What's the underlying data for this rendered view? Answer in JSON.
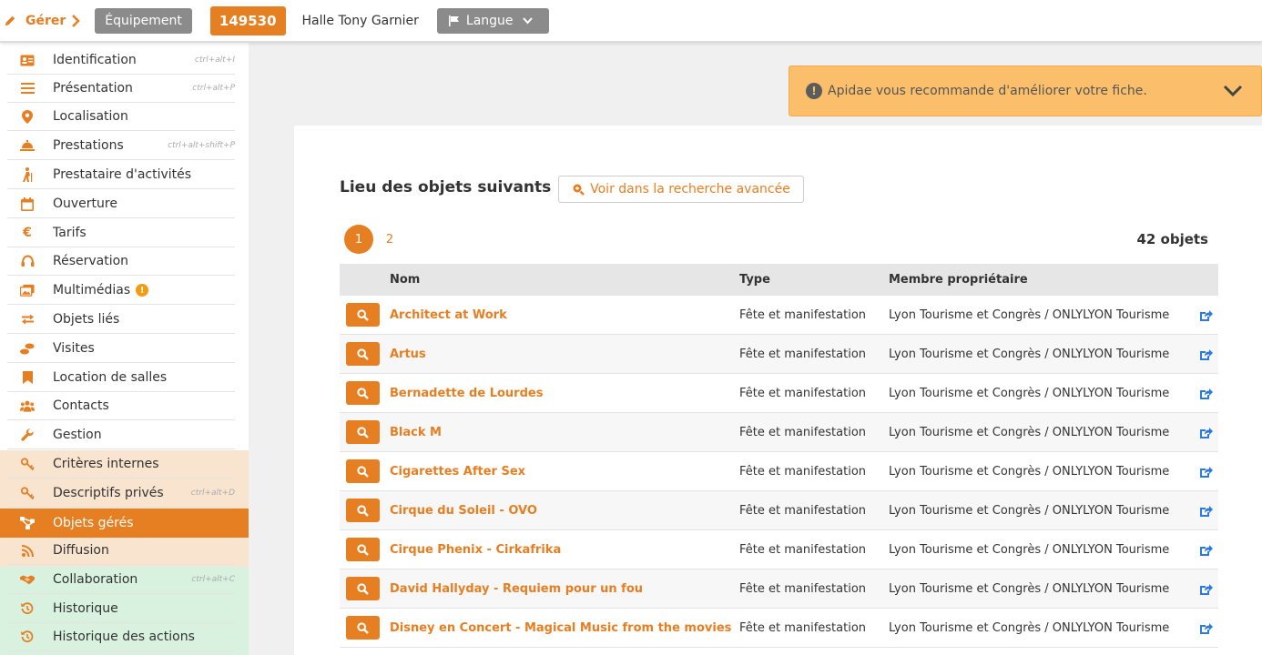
{
  "colors": {
    "accent": "#e67e22",
    "warning": "#fbbf6b",
    "link": "#2a7ae2"
  },
  "topbar": {
    "manage_label": "Gérer",
    "type_label": "Équipement",
    "object_id": "149530",
    "object_name": "Halle Tony Garnier",
    "language_label": "Langue"
  },
  "sidebar": {
    "items": [
      {
        "label": "Identification",
        "icon": "id-card-icon",
        "shortcut": "ctrl+alt+I"
      },
      {
        "label": "Présentation",
        "icon": "list-icon",
        "shortcut": "ctrl+alt+P"
      },
      {
        "label": "Localisation",
        "icon": "map-pin-icon",
        "shortcut": ""
      },
      {
        "label": "Prestations",
        "icon": "service-bell-icon",
        "shortcut": "ctrl+alt+shift+P"
      },
      {
        "label": "Prestataire d'activités",
        "icon": "hiker-icon",
        "shortcut": ""
      },
      {
        "label": "Ouverture",
        "icon": "calendar-icon",
        "shortcut": ""
      },
      {
        "label": "Tarifs",
        "icon": "euro-icon",
        "shortcut": ""
      },
      {
        "label": "Réservation",
        "icon": "headset-icon",
        "shortcut": ""
      },
      {
        "label": "Multimédias",
        "icon": "images-icon",
        "shortcut": "",
        "badge": "!"
      },
      {
        "label": "Objets liés",
        "icon": "exchange-icon",
        "shortcut": ""
      },
      {
        "label": "Visites",
        "icon": "footsteps-icon",
        "shortcut": ""
      },
      {
        "label": "Location de salles",
        "icon": "bookmark-icon",
        "shortcut": ""
      },
      {
        "label": "Contacts",
        "icon": "users-icon",
        "shortcut": ""
      },
      {
        "label": "Gestion",
        "icon": "wrench-icon",
        "shortcut": ""
      },
      {
        "label": "Critères internes",
        "icon": "key-icon",
        "shortcut": ""
      },
      {
        "label": "Descriptifs privés",
        "icon": "key-icon",
        "shortcut": "ctrl+alt+D"
      },
      {
        "label": "Objets gérés",
        "icon": "sitemap-icon",
        "shortcut": ""
      },
      {
        "label": "Diffusion",
        "icon": "rss-icon",
        "shortcut": ""
      },
      {
        "label": "Collaboration",
        "icon": "handshake-icon",
        "shortcut": "ctrl+alt+C"
      },
      {
        "label": "Historique",
        "icon": "history-icon",
        "shortcut": ""
      },
      {
        "label": "Historique des actions",
        "icon": "history-icon",
        "shortcut": ""
      }
    ]
  },
  "alert": {
    "text": "Apidae vous recommande d'améliorer votre fiche."
  },
  "main": {
    "title": "Lieu des objets suivants",
    "advanced_search_label": "Voir dans la recherche avancée",
    "pages": [
      "1",
      "2"
    ],
    "current_page": "1",
    "count_label": "42 objets",
    "columns": {
      "name": "Nom",
      "type": "Type",
      "owner": "Membre propriétaire"
    },
    "rows": [
      {
        "name": "Architect at Work",
        "type": "Fête et manifestation",
        "owner": "Lyon Tourisme et Congrès / ONLYLYON Tourisme"
      },
      {
        "name": "Artus",
        "type": "Fête et manifestation",
        "owner": "Lyon Tourisme et Congrès / ONLYLYON Tourisme"
      },
      {
        "name": "Bernadette de Lourdes",
        "type": "Fête et manifestation",
        "owner": "Lyon Tourisme et Congrès / ONLYLYON Tourisme"
      },
      {
        "name": "Black M",
        "type": "Fête et manifestation",
        "owner": "Lyon Tourisme et Congrès / ONLYLYON Tourisme"
      },
      {
        "name": "Cigarettes After Sex",
        "type": "Fête et manifestation",
        "owner": "Lyon Tourisme et Congrès / ONLYLYON Tourisme"
      },
      {
        "name": "Cirque du Soleil - OVO",
        "type": "Fête et manifestation",
        "owner": "Lyon Tourisme et Congrès / ONLYLYON Tourisme"
      },
      {
        "name": "Cirque Phenix - Cirkafrika",
        "type": "Fête et manifestation",
        "owner": "Lyon Tourisme et Congrès / ONLYLYON Tourisme"
      },
      {
        "name": "David Hallyday - Requiem pour un fou",
        "type": "Fête et manifestation",
        "owner": "Lyon Tourisme et Congrès / ONLYLYON Tourisme"
      },
      {
        "name": "Disney en Concert - Magical Music from the movies",
        "type": "Fête et manifestation",
        "owner": "Lyon Tourisme et Congrès / ONLYLYON Tourisme"
      }
    ]
  }
}
